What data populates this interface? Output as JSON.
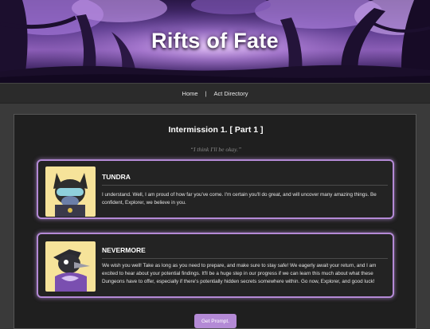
{
  "banner": {
    "title": "Rifts of Fate"
  },
  "nav": {
    "home": "Home",
    "separator": "|",
    "act_directory": "Act Directory"
  },
  "page": {
    "title": "Intermission 1. [ Part 1 ]",
    "quote": "“I think I'll be okay.”"
  },
  "cards": [
    {
      "name": "TUNDRA",
      "text": "I understand. Well, I am proud of how far you've come. I'm certain you'll do great, and will uncover many amazing things. Be confident, Explorer, we believe in you.",
      "avatar_icon": "fox-character-icon"
    },
    {
      "name": "NEVERMORE",
      "text": "We wish you well! Take as long as you need to prepare, and make sure to stay safe! We eagerly await your return, and I am excited to hear about your potential findings. It'll be a huge step in our progress if we can learn this much about what these Dungeons have to offer, especially if there's potentially hidden secrets somewhere within. Go now, Explorer, and good luck!",
      "avatar_icon": "bird-character-icon"
    }
  ],
  "button": {
    "label": "Get Prompt."
  },
  "colors": {
    "accent": "#b48ad6",
    "panel": "#1f1f1f",
    "page_bg": "#3a3a3a"
  }
}
